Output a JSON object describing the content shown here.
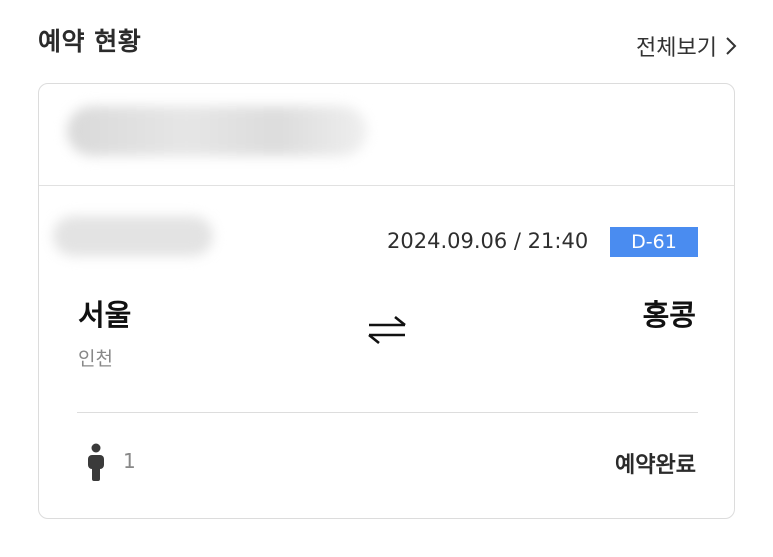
{
  "header": {
    "title": "예약 현황",
    "view_all": "전체보기"
  },
  "reservation": {
    "datetime": "2024.09.06 / 21:40",
    "dday": "D-61",
    "from_city": "서울",
    "from_airport": "인천",
    "to_city": "홍콩",
    "passengers": "1",
    "status": "예약완료"
  },
  "icons": {
    "view_all": "chevron-right-icon",
    "swap": "swap-arrows-icon",
    "passenger": "person-icon"
  },
  "colors": {
    "dday_badge": "#4a8cf0",
    "card_border": "#dcdcdc"
  }
}
